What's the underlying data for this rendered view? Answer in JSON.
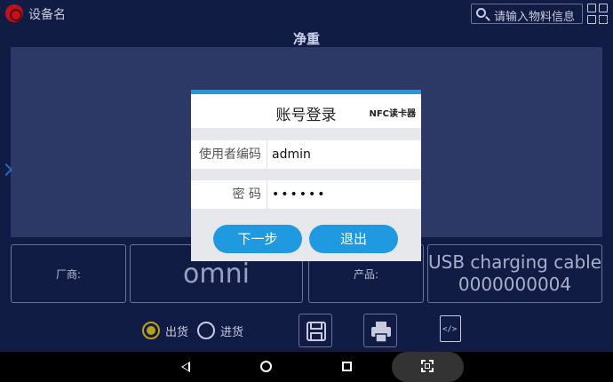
{
  "header": {
    "device_name": "设备名",
    "search_placeholder": "请输入物料信息",
    "weight_label": "净重"
  },
  "info_boxes": {
    "manufacturer_label": "厂商:",
    "manufacturer_value": "omni",
    "product_label": "产品:",
    "product_name": "USB charging cable",
    "product_code": "0000000004"
  },
  "mode": {
    "options": [
      {
        "label": "出货",
        "selected": true
      },
      {
        "label": "进货",
        "selected": false
      }
    ]
  },
  "login_dialog": {
    "title": "账号登录",
    "nfc_label": "NFC读卡器",
    "user_label": "使用者编码",
    "user_value": "admin",
    "password_label": "密 码",
    "password_value": "••••••",
    "next_label": "下一步",
    "exit_label": "退出"
  },
  "colors": {
    "background": "#111c45",
    "display_panel": "#2c3866",
    "accent_blue": "#1f9ae0",
    "radio_selected": "#b9a21a",
    "logo_red": "#c0121b"
  },
  "icons": [
    "app-logo-icon",
    "search-icon",
    "grid-icon",
    "save-icon",
    "print-icon",
    "code-file-icon",
    "back-icon",
    "home-icon",
    "recents-icon",
    "screenshot-icon"
  ]
}
